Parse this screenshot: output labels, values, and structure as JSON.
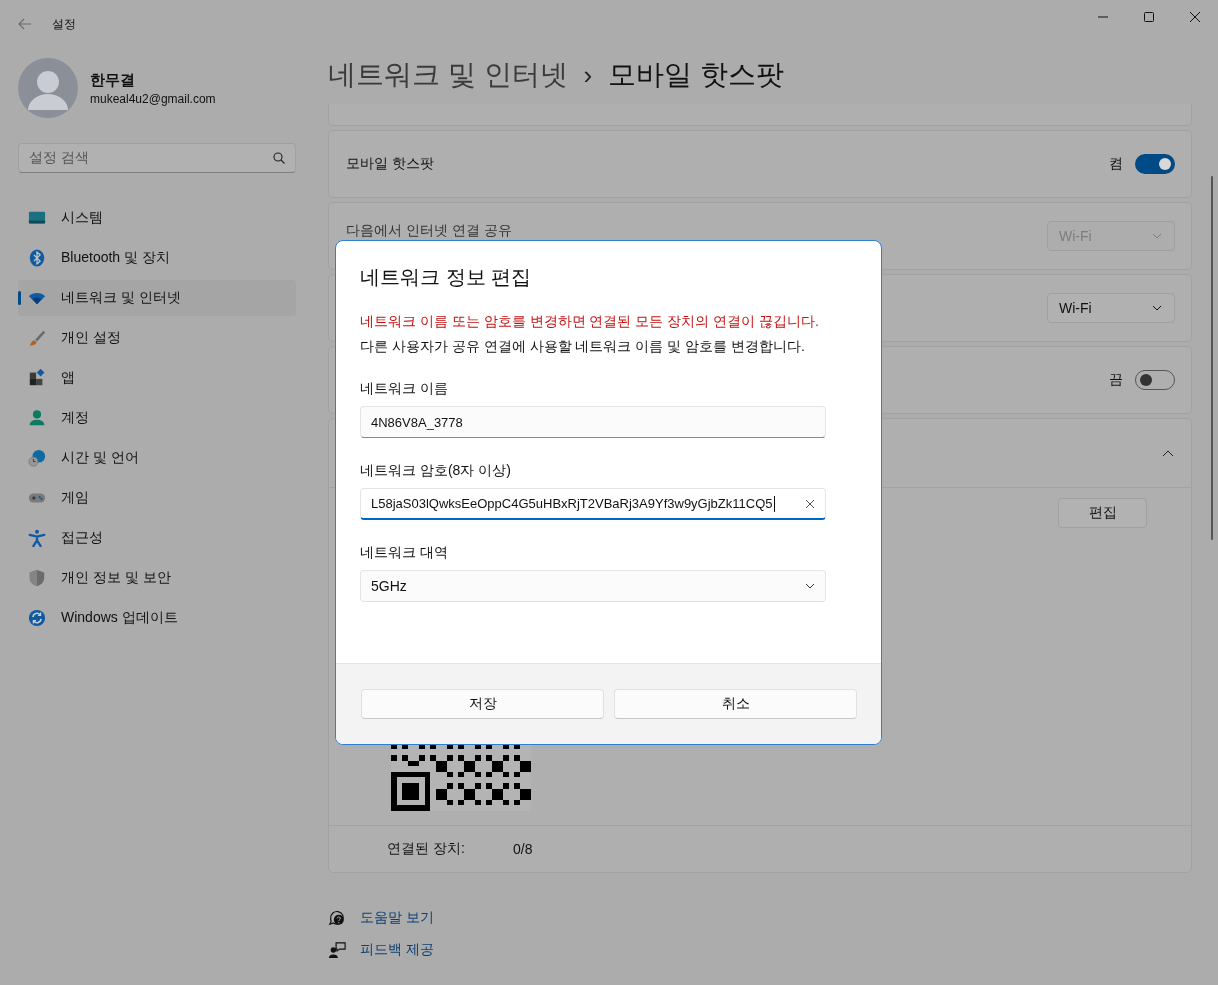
{
  "window": {
    "title": "설정"
  },
  "profile": {
    "name": "한무결",
    "email": "mukeal4u2@gmail.com"
  },
  "search": {
    "placeholder": "설정 검색"
  },
  "sidebar": {
    "items": [
      {
        "label": "시스템",
        "selected": false
      },
      {
        "label": "Bluetooth 및 장치",
        "selected": false
      },
      {
        "label": "네트워크 및 인터넷",
        "selected": true
      },
      {
        "label": "개인 설정",
        "selected": false
      },
      {
        "label": "앱",
        "selected": false
      },
      {
        "label": "계정",
        "selected": false
      },
      {
        "label": "시간 및 언어",
        "selected": false
      },
      {
        "label": "게임",
        "selected": false
      },
      {
        "label": "접근성",
        "selected": false
      },
      {
        "label": "개인 정보 및 보안",
        "selected": false
      },
      {
        "label": "Windows 업데이트",
        "selected": false
      }
    ]
  },
  "breadcrumb": {
    "parent": "네트워크 및 인터넷",
    "separator": "›",
    "current": "모바일 핫스팟"
  },
  "settings": [
    {
      "kind": "toggle",
      "label": "모바일 핫스팟",
      "state_text": "켬",
      "on": true
    },
    {
      "kind": "dropdown",
      "label": "다음에서 인터넷 연결 공유",
      "value": "Wi-Fi",
      "disabled": true
    },
    {
      "kind": "dropdown",
      "value": "Wi-Fi",
      "disabled": false
    },
    {
      "kind": "toggle",
      "state_text": "끔",
      "on": false
    },
    {
      "kind": "expander",
      "expanded": true,
      "edit_button": "편집",
      "connected_label": "연결된 장치:",
      "connected_value": "0/8"
    }
  ],
  "help_links": [
    {
      "label": "도움말 보기"
    },
    {
      "label": "피드백 제공"
    }
  ],
  "dialog": {
    "title": "네트워크 정보 편집",
    "warning": "네트워크 이름 또는 암호를 변경하면 연결된 모든 장치의 연결이 끊깁니다.",
    "description": "다른 사용자가 공유 연결에 사용할 네트워크 이름 및 암호를 변경합니다.",
    "fields": [
      {
        "kind": "text",
        "label": "네트워크 이름",
        "value": "4N86V8A_3778",
        "focused": false
      },
      {
        "kind": "text",
        "label": "네트워크 암호(8자 이상)",
        "value": "L58jaS03lQwksEeOppC4G5uHBxRjT2VBaRj3A9Yf3w9yGjbZk11CQ5",
        "focused": true
      },
      {
        "kind": "select",
        "label": "네트워크 대역",
        "value": "5GHz"
      }
    ],
    "buttons": [
      "저장",
      "취소"
    ]
  }
}
